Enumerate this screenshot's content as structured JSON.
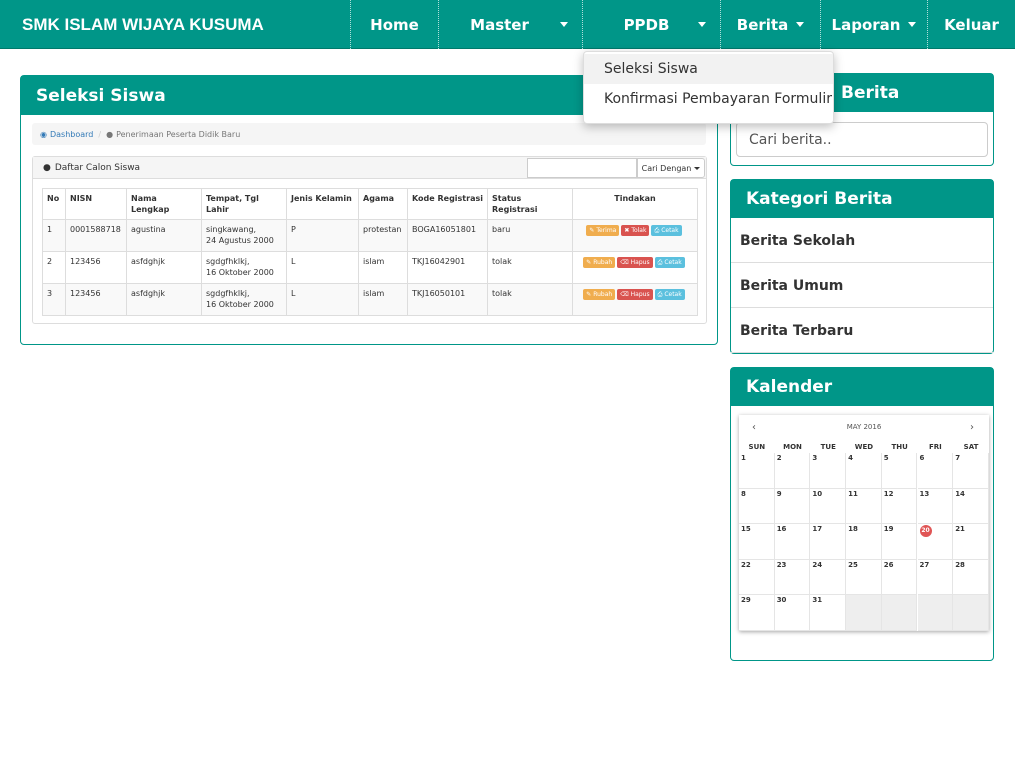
{
  "brand": "SMK ISLAM WIJAYA KUSUMA",
  "nav": {
    "home": "Home",
    "master": "Master",
    "ppdb": "PPDB",
    "berita": "Berita",
    "laporan": "Laporan",
    "keluar": "Keluar"
  },
  "ppdb_menu": {
    "item1": "Seleksi Siswa",
    "item2": "Konfirmasi Pembayaran Formulir"
  },
  "main": {
    "title": "Seleksi Siswa",
    "breadcrumb": {
      "home": "Dashboard",
      "current": "Penerimaan Peserta Didik Baru"
    },
    "list_title": "Daftar Calon Siswa",
    "search_button": "Cari Dengan",
    "columns": [
      "No",
      "NISN",
      "Nama Lengkap",
      "Tempat, Tgl Lahir",
      "Jenis Kelamin",
      "Agama",
      "Kode Registrasi",
      "Status Registrasi",
      "Tindakan"
    ],
    "rows": [
      {
        "no": "1",
        "nisn": "0001588718",
        "nama": "agustina",
        "ttl1": "singkawang,",
        "ttl2": "24 Agustus 2000",
        "jk": "P",
        "agama": "protestan",
        "kode": "BOGA16051801",
        "status": "baru",
        "actions": [
          "Terima",
          "Tolak",
          "Cetak"
        ]
      },
      {
        "no": "2",
        "nisn": "123456",
        "nama": "asfdghjk",
        "ttl1": "sgdgfhklkj,",
        "ttl2": "16 Oktober 2000",
        "jk": "L",
        "agama": "islam",
        "kode": "TKJ16042901",
        "status": "tolak",
        "actions": [
          "Rubah",
          "Hapus",
          "Cetak"
        ]
      },
      {
        "no": "3",
        "nisn": "123456",
        "nama": "asfdghjk",
        "ttl1": "sgdgfhklkj,",
        "ttl2": "16 Oktober 2000",
        "jk": "L",
        "agama": "islam",
        "kode": "TKJ16050101",
        "status": "tolak",
        "actions": [
          "Rubah",
          "Hapus",
          "Cetak"
        ]
      }
    ]
  },
  "sidebar": {
    "cari_title_partial": "Berita",
    "search_placeholder": "Cari berita..",
    "kategori_title": "Kategori Berita",
    "kategori": [
      "Berita Sekolah",
      "Berita Umum",
      "Berita Terbaru"
    ],
    "kalender_title": "Kalender"
  },
  "calendar": {
    "month_label": "MAY 2016",
    "prev": "‹",
    "next": "›",
    "dow": [
      "SUN",
      "MON",
      "TUE",
      "WED",
      "THU",
      "FRI",
      "SAT"
    ],
    "weeks": [
      [
        "1",
        "2",
        "3",
        "4",
        "5",
        "6",
        "7"
      ],
      [
        "8",
        "9",
        "10",
        "11",
        "12",
        "13",
        "14"
      ],
      [
        "15",
        "16",
        "17",
        "18",
        "19",
        "20",
        "21"
      ],
      [
        "22",
        "23",
        "24",
        "25",
        "26",
        "27",
        "28"
      ],
      [
        "29",
        "30",
        "31",
        "",
        "",
        "",
        ""
      ]
    ],
    "today": "20"
  },
  "colors": {
    "primary": "#009688",
    "warning": "#f0ad4e",
    "danger": "#d9534f",
    "info": "#5bc0de",
    "today": "#e05555"
  },
  "icons": {
    "dashboard": "dashboard-icon",
    "user": "user-icon",
    "edit": "edit-icon",
    "times": "times-icon",
    "trash": "trash-icon",
    "print": "print-icon"
  }
}
